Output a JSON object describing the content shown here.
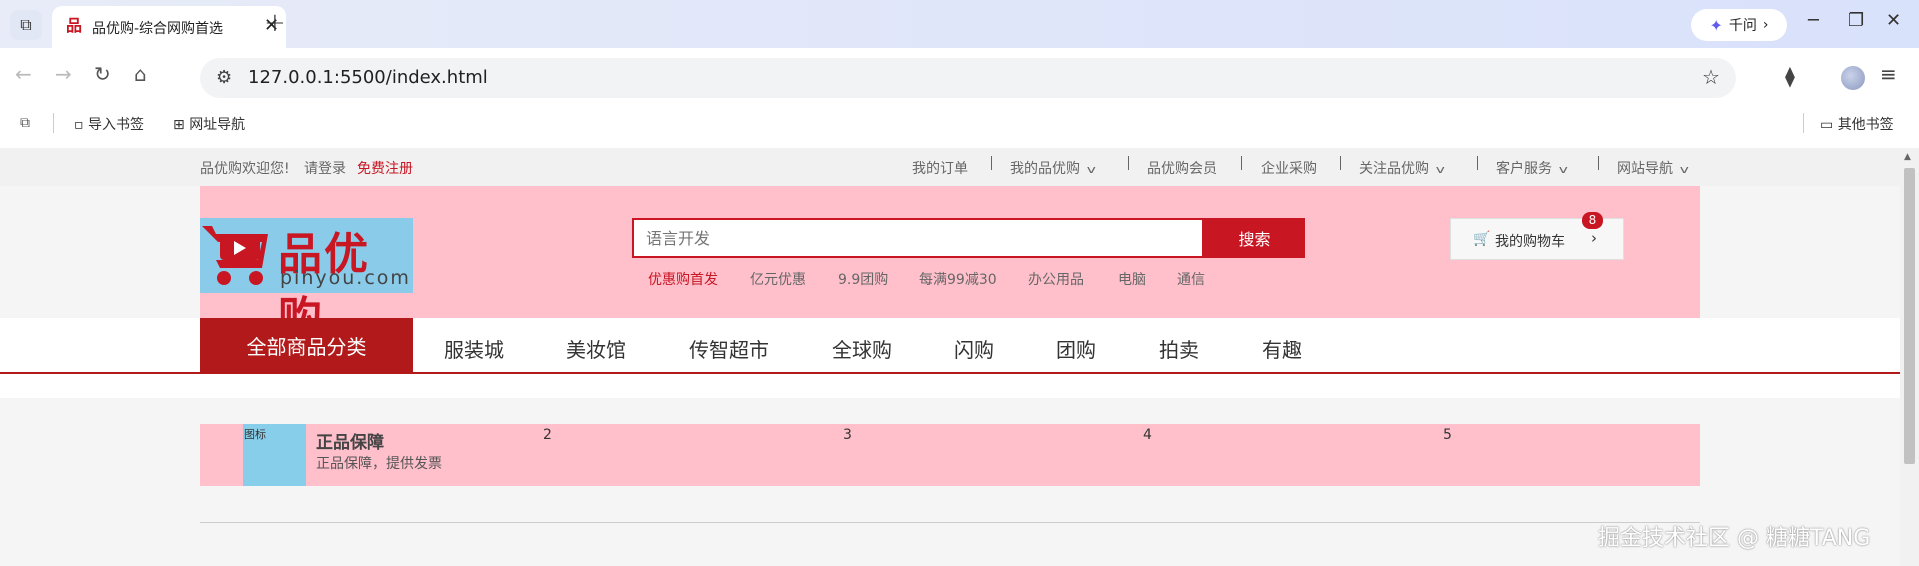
{
  "browser": {
    "tab_title": "品优购-综合网购首选",
    "url": "127.0.0.1:5500/index.html",
    "qianwen_label": "千问",
    "bookmarks": [
      "导入书签",
      "网址导航"
    ],
    "other_bookmarks": "其他书签"
  },
  "shortcut": {
    "welcome": "品优购欢迎您!",
    "login": "请登录",
    "register": "免费注册",
    "links": [
      "我的订单",
      "我的品优购",
      "品优购会员",
      "企业采购",
      "关注品优购",
      "客户服务",
      "网站导航"
    ]
  },
  "header": {
    "logo_title": "品优购",
    "logo_sub": "pinyou.com",
    "search_placeholder": "语言开发",
    "search_button": "搜索",
    "hotwords": [
      "优惠购首发",
      "亿元优惠",
      "9.9团购",
      "每满99减30",
      "办公用品",
      "电脑",
      "通信"
    ],
    "cart_label": "我的购物车",
    "cart_count": "8"
  },
  "nav": {
    "all_categories": "全部商品分类",
    "items": [
      "服装城",
      "美妆馆",
      "传智超市",
      "全球购",
      "闪购",
      "团购",
      "拍卖",
      "有趣"
    ]
  },
  "service": {
    "icon_label": "图标",
    "title": "正品保障",
    "desc": "正品保障，提供发票",
    "numbers": [
      "2",
      "3",
      "4",
      "5"
    ]
  },
  "watermark": "掘金技术社区 @ 糖糖TANG"
}
